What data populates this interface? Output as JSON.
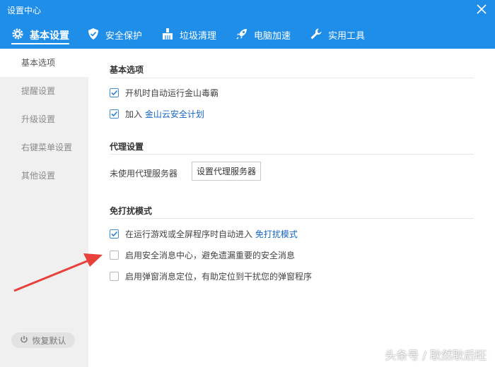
{
  "window": {
    "title": "设置中心"
  },
  "colors": {
    "header": "#1f8ee8",
    "link": "#1465c0",
    "arrow": "#e8403a"
  },
  "tabs": [
    {
      "label": "基本设置",
      "icon": "gear-icon",
      "active": true
    },
    {
      "label": "安全保护",
      "icon": "shield-icon",
      "active": false
    },
    {
      "label": "垃圾清理",
      "icon": "broom-icon",
      "active": false
    },
    {
      "label": "电脑加速",
      "icon": "rocket-icon",
      "active": false
    },
    {
      "label": "实用工具",
      "icon": "wrench-icon",
      "active": false
    }
  ],
  "sidebar": {
    "items": [
      {
        "label": "基本选项",
        "active": true
      },
      {
        "label": "提醒设置",
        "active": false
      },
      {
        "label": "升级设置",
        "active": false
      },
      {
        "label": "右键菜单设置",
        "active": false
      },
      {
        "label": "其他设置",
        "active": false
      }
    ],
    "restore_label": "恢复默认"
  },
  "main": {
    "basic": {
      "title": "基本选项",
      "opt1": {
        "text": "开机时自动运行金山毒霸",
        "checked": true
      },
      "opt2": {
        "prefix": "加入 ",
        "link": "金山云安全计划",
        "checked": true
      }
    },
    "proxy": {
      "title": "代理设置",
      "status": "未使用代理服务器",
      "button": "设置代理服务器"
    },
    "dnd": {
      "title": "免打扰模式",
      "opt1": {
        "prefix": "在运行游戏或全屏程序时自动进入 ",
        "link": "免打扰模式",
        "checked": true
      },
      "opt2": {
        "text": "启用安全消息中心，避免遗漏重要的安全消息",
        "checked": false
      },
      "opt3": {
        "text": "启用弹窗消息定位，有助定位到干扰您的弹窗程序",
        "checked": false
      }
    }
  },
  "watermark": "头条号 / 耿然耿后旺"
}
